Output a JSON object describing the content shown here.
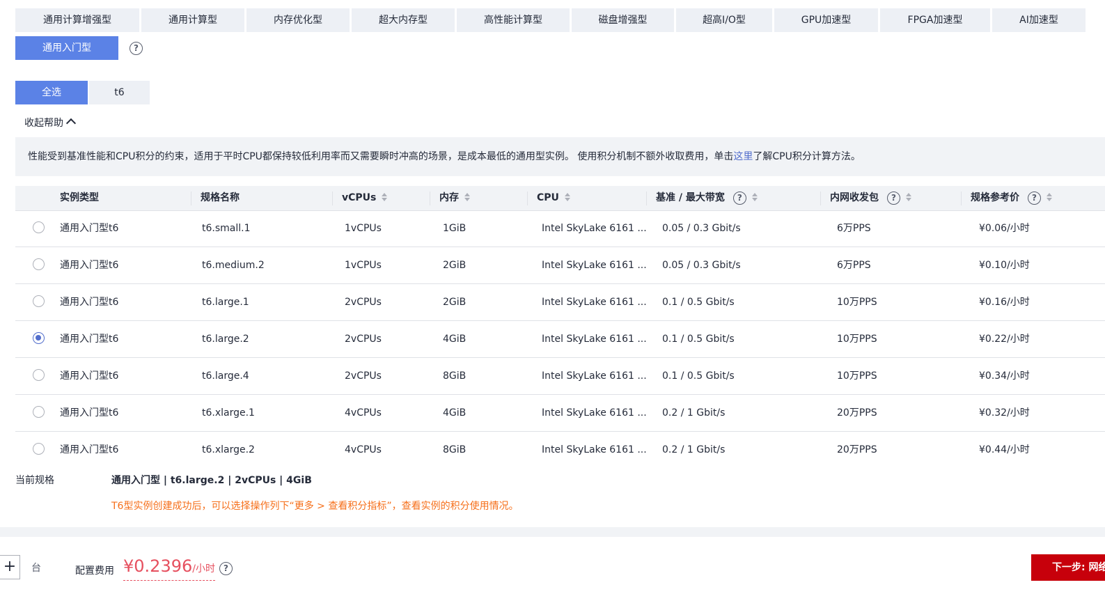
{
  "categories": [
    {
      "label": "通用计算增强型"
    },
    {
      "label": "通用计算型"
    },
    {
      "label": "内存优化型"
    },
    {
      "label": "超大内存型"
    },
    {
      "label": "高性能计算型"
    },
    {
      "label": "磁盘增强型"
    },
    {
      "label": "超高I/O型"
    },
    {
      "label": "GPU加速型"
    },
    {
      "label": "FPGA加速型"
    },
    {
      "label": "AI加速型"
    },
    {
      "label": "通用入门型",
      "selected": true
    }
  ],
  "help_icon_glyph": "?",
  "series_filter": [
    {
      "label": "全选",
      "selected": true
    },
    {
      "label": "t6"
    }
  ],
  "collapse_help": {
    "label": "收起帮助"
  },
  "help_box": {
    "text_before": "性能受到基准性能和CPU积分的约束，适用于平时CPU都保持较低利用率而又需要瞬时冲高的场景，是成本最低的通用型实例。 使用积分机制不额外收取费用，单击",
    "link_text": "这里",
    "text_after": "了解CPU积分计算方法。"
  },
  "table": {
    "headers": {
      "type": "实例类型",
      "name": "规格名称",
      "vcpus": "vCPUs",
      "memory": "内存",
      "cpu": "CPU",
      "bandwidth": "基准 / 最大带宽",
      "pps": "内网收发包",
      "price": "规格参考价"
    },
    "rows": [
      {
        "type": "通用入门型t6",
        "name": "t6.small.1",
        "vcpus": "1vCPUs",
        "memory": "1GiB",
        "cpu": "Intel SkyLake 6161 ...",
        "bandwidth": "0.05 / 0.3 Gbit/s",
        "pps": "6万PPS",
        "price": "¥0.06/小时",
        "selected": false
      },
      {
        "type": "通用入门型t6",
        "name": "t6.medium.2",
        "vcpus": "1vCPUs",
        "memory": "2GiB",
        "cpu": "Intel SkyLake 6161 ...",
        "bandwidth": "0.05 / 0.3 Gbit/s",
        "pps": "6万PPS",
        "price": "¥0.10/小时",
        "selected": false
      },
      {
        "type": "通用入门型t6",
        "name": "t6.large.1",
        "vcpus": "2vCPUs",
        "memory": "2GiB",
        "cpu": "Intel SkyLake 6161 ...",
        "bandwidth": "0.1 / 0.5 Gbit/s",
        "pps": "10万PPS",
        "price": "¥0.16/小时",
        "selected": false
      },
      {
        "type": "通用入门型t6",
        "name": "t6.large.2",
        "vcpus": "2vCPUs",
        "memory": "4GiB",
        "cpu": "Intel SkyLake 6161 ...",
        "bandwidth": "0.1 / 0.5 Gbit/s",
        "pps": "10万PPS",
        "price": "¥0.22/小时",
        "selected": true
      },
      {
        "type": "通用入门型t6",
        "name": "t6.large.4",
        "vcpus": "2vCPUs",
        "memory": "8GiB",
        "cpu": "Intel SkyLake 6161 ...",
        "bandwidth": "0.1 / 0.5 Gbit/s",
        "pps": "10万PPS",
        "price": "¥0.34/小时",
        "selected": false
      },
      {
        "type": "通用入门型t6",
        "name": "t6.xlarge.1",
        "vcpus": "4vCPUs",
        "memory": "4GiB",
        "cpu": "Intel SkyLake 6161 ...",
        "bandwidth": "0.2 / 1 Gbit/s",
        "pps": "20万PPS",
        "price": "¥0.32/小时",
        "selected": false
      },
      {
        "type": "通用入门型t6",
        "name": "t6.xlarge.2",
        "vcpus": "4vCPUs",
        "memory": "8GiB",
        "cpu": "Intel SkyLake 6161 ...",
        "bandwidth": "0.2 / 1 Gbit/s",
        "pps": "20万PPS",
        "price": "¥0.44/小时",
        "selected": false
      }
    ]
  },
  "current_spec": {
    "label": "当前规格",
    "value": "通用入门型 | t6.large.2 | 2vCPUs | 4GiB",
    "note": "T6型实例创建成功后，可以选择操作列下“更多 > 查看积分指标”，查看实例的积分使用情况。"
  },
  "footer": {
    "plus": "+",
    "unit": "台",
    "fee_label": "配置费用",
    "price": "¥0.2396",
    "price_unit": "/小时",
    "next_button": "下一步: 网络配置"
  },
  "colors": {
    "accent": "#5b82e6",
    "link": "#526ecc",
    "warning_note": "#f66f1a",
    "price": "#e6505f",
    "primary_button": "#c7000b"
  }
}
